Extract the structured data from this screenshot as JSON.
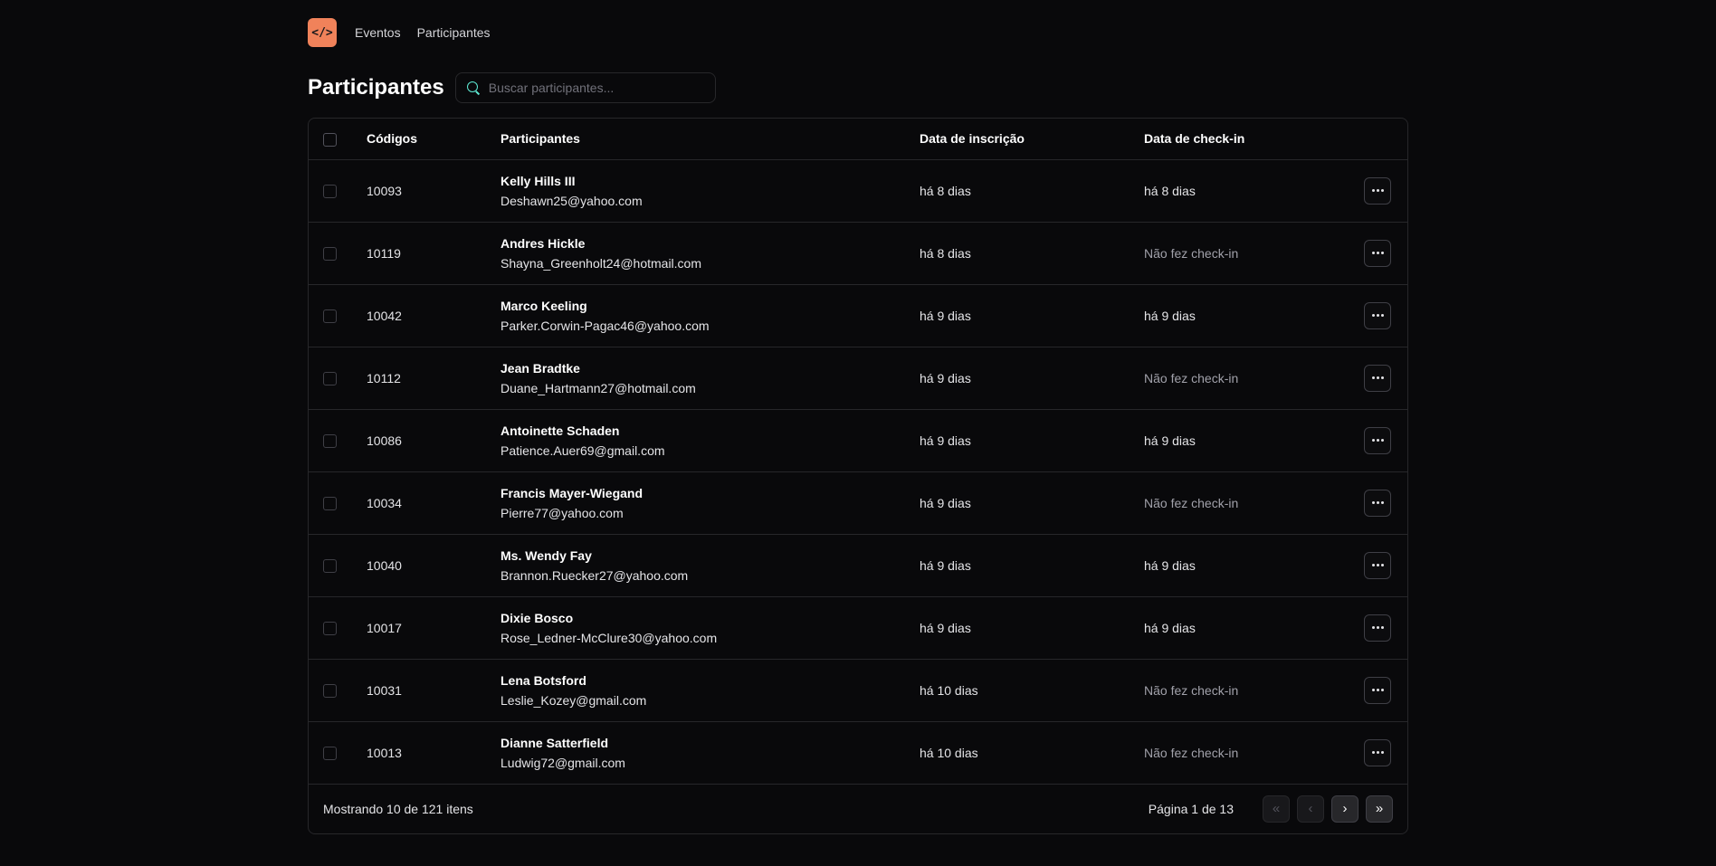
{
  "header": {
    "logo_text": "</>",
    "nav": [
      {
        "label": "Eventos"
      },
      {
        "label": "Participantes"
      }
    ]
  },
  "page": {
    "title": "Participantes",
    "search_placeholder": "Buscar participantes..."
  },
  "table": {
    "columns": {
      "code": "Códigos",
      "participant": "Participantes",
      "registered": "Data de inscrição",
      "checkin": "Data de check-in"
    },
    "rows": [
      {
        "code": "10093",
        "name": "Kelly Hills III",
        "email": "Deshawn25@yahoo.com",
        "registered": "há 8 dias",
        "checkin": "há 8 dias",
        "checked": true
      },
      {
        "code": "10119",
        "name": "Andres Hickle",
        "email": "Shayna_Greenholt24@hotmail.com",
        "registered": "há 8 dias",
        "checkin": "Não fez check-in",
        "checked": false
      },
      {
        "code": "10042",
        "name": "Marco Keeling",
        "email": "Parker.Corwin-Pagac46@yahoo.com",
        "registered": "há 9 dias",
        "checkin": "há 9 dias",
        "checked": true
      },
      {
        "code": "10112",
        "name": "Jean Bradtke",
        "email": "Duane_Hartmann27@hotmail.com",
        "registered": "há 9 dias",
        "checkin": "Não fez check-in",
        "checked": false
      },
      {
        "code": "10086",
        "name": "Antoinette Schaden",
        "email": "Patience.Auer69@gmail.com",
        "registered": "há 9 dias",
        "checkin": "há 9 dias",
        "checked": true
      },
      {
        "code": "10034",
        "name": "Francis Mayer-Wiegand",
        "email": "Pierre77@yahoo.com",
        "registered": "há 9 dias",
        "checkin": "Não fez check-in",
        "checked": false
      },
      {
        "code": "10040",
        "name": "Ms. Wendy Fay",
        "email": "Brannon.Ruecker27@yahoo.com",
        "registered": "há 9 dias",
        "checkin": "há 9 dias",
        "checked": true
      },
      {
        "code": "10017",
        "name": "Dixie Bosco",
        "email": "Rose_Ledner-McClure30@yahoo.com",
        "registered": "há 9 dias",
        "checkin": "há 9 dias",
        "checked": true
      },
      {
        "code": "10031",
        "name": "Lena Botsford",
        "email": "Leslie_Kozey@gmail.com",
        "registered": "há 10 dias",
        "checkin": "Não fez check-in",
        "checked": false
      },
      {
        "code": "10013",
        "name": "Dianne Satterfield",
        "email": "Ludwig72@gmail.com",
        "registered": "há 10 dias",
        "checkin": "Não fez check-in",
        "checked": false
      }
    ]
  },
  "footer": {
    "showing": "Mostrando 10 de 121 itens",
    "page_info": "Página 1 de 13",
    "buttons": {
      "first": "«",
      "prev": "‹",
      "next": "›",
      "last": "»"
    }
  },
  "colors": {
    "background": "#09090b",
    "accent": "#f0825a",
    "border": "#27272a"
  }
}
